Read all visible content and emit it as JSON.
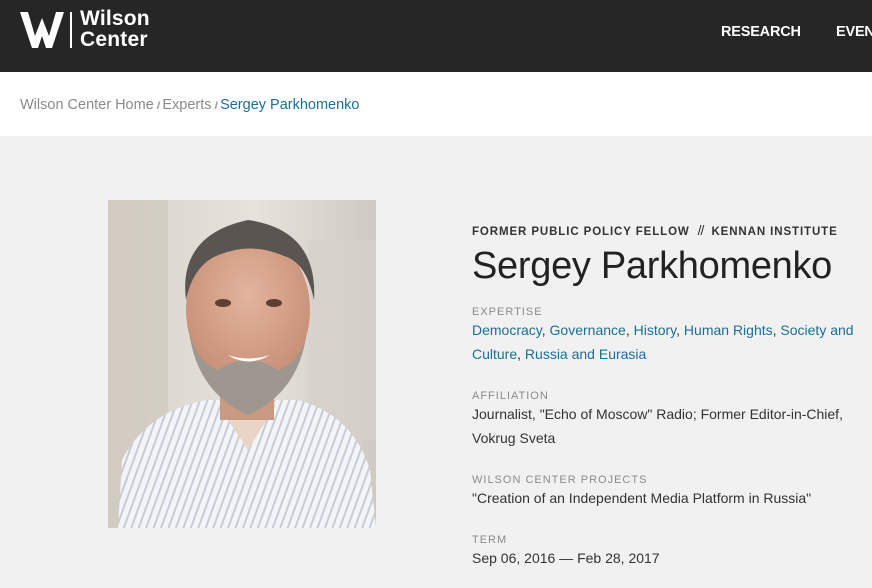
{
  "header": {
    "logo_line1": "Wilson",
    "logo_line2": "Center",
    "nav": [
      "RESEARCH",
      "EVEN"
    ]
  },
  "breadcrumb": {
    "items": [
      "Wilson Center Home",
      "Experts"
    ],
    "current": "Sergey Parkhomenko",
    "separator": "//"
  },
  "profile": {
    "role": "FORMER PUBLIC POLICY FELLOW",
    "role_separator": "//",
    "institute": "KENNAN INSTITUTE",
    "name": "Sergey Parkhomenko",
    "expertise_label": "EXPERTISE",
    "expertise": [
      "Democracy",
      "Governance",
      "History",
      "Human Rights",
      "Society and Culture",
      "Russia and Eurasia"
    ],
    "affiliation_label": "AFFILIATION",
    "affiliation": "Journalist, \"Echo of Moscow\" Radio; Former Editor-in-Chief, Vokrug Sveta",
    "projects_label": "WILSON CENTER PROJECTS",
    "projects": "\"Creation of an Independent Media Platform in Russia\"",
    "term_label": "TERM",
    "term": "Sep 06, 2016 — Feb 28, 2017"
  },
  "colors": {
    "header_bg": "#262626",
    "link": "#1d6e96",
    "page_bg": "#f1f1f1"
  }
}
